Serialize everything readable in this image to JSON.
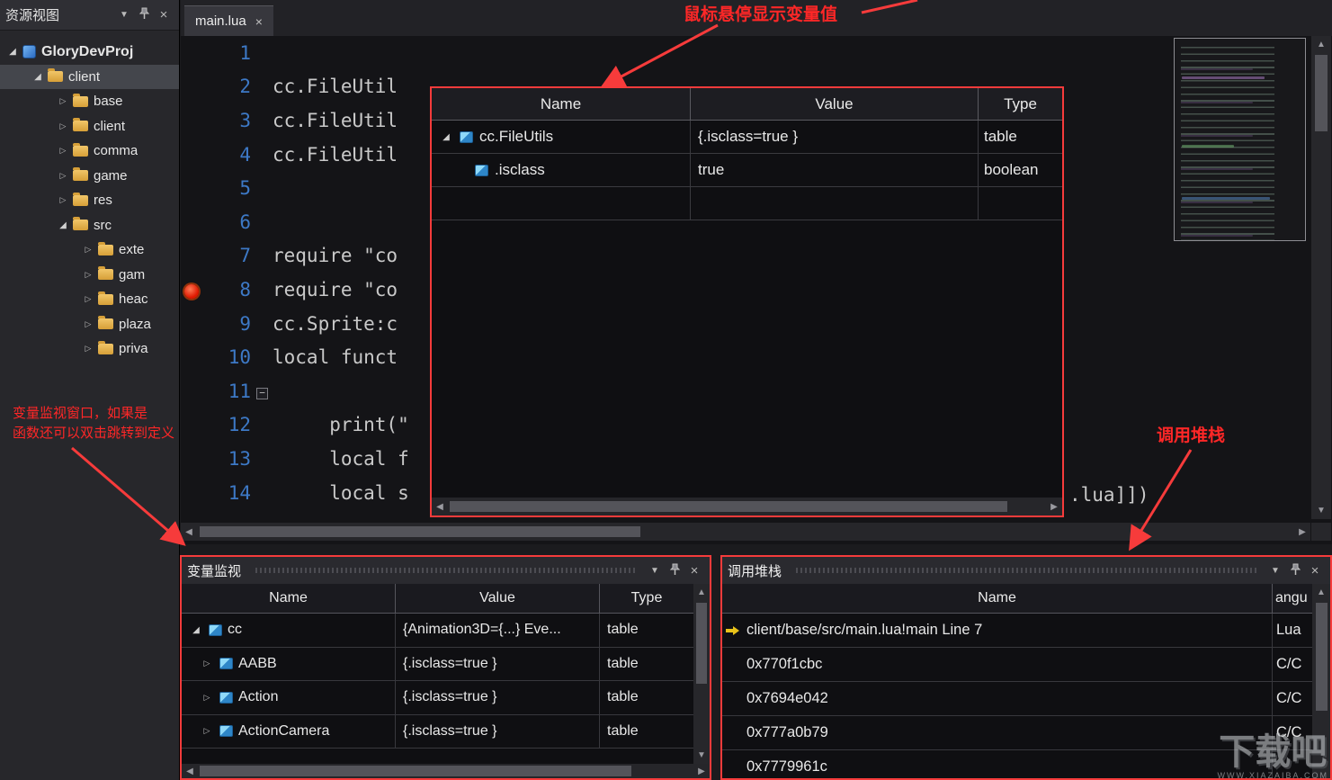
{
  "icons": {
    "chevron": "▼",
    "close": "×",
    "up": "▲",
    "down": "▼",
    "left": "◀",
    "right": "▶",
    "collapsed": "▷",
    "expanded": "◢",
    "fold": "−"
  },
  "resource_panel": {
    "title": "资源视图",
    "tree": [
      {
        "label": "GloryDevProj"
      },
      {
        "label": "client"
      },
      {
        "label": "base"
      },
      {
        "label": "client"
      },
      {
        "label": "comma"
      },
      {
        "label": "game"
      },
      {
        "label": "res"
      },
      {
        "label": "src"
      },
      {
        "label": "exte"
      },
      {
        "label": "gam"
      },
      {
        "label": "heac"
      },
      {
        "label": "plaza"
      },
      {
        "label": "priva"
      }
    ]
  },
  "editor": {
    "tab": "main.lua",
    "lines": [
      {
        "n": "1",
        "t": ""
      },
      {
        "n": "2",
        "t": "cc.FileUtil"
      },
      {
        "n": "3",
        "t": "cc.FileUtil"
      },
      {
        "n": "4",
        "t": "cc.FileUtil"
      },
      {
        "n": "5",
        "t": ""
      },
      {
        "n": "6",
        "t": ""
      },
      {
        "n": "7",
        "t": "require \"co"
      },
      {
        "n": "8",
        "t": "require \"co"
      },
      {
        "n": "9",
        "t": "cc.Sprite:c"
      },
      {
        "n": "10",
        "t": "local funct"
      },
      {
        "n": "11",
        "t": ""
      },
      {
        "n": "12",
        "t": "     print(\""
      },
      {
        "n": "13",
        "t": "     local f"
      },
      {
        "n": "14",
        "t": "     local s"
      }
    ],
    "line13_tail": ".lua]])"
  },
  "hover_popup": {
    "columns": [
      "Name",
      "Value",
      "Type"
    ],
    "rows": [
      {
        "name": "cc.FileUtils",
        "value": "{.isclass=true }",
        "type": "table"
      },
      {
        "name": ".isclass",
        "value": "true",
        "type": "boolean"
      },
      {
        "name": "",
        "value": "",
        "type": ""
      }
    ]
  },
  "watch_panel": {
    "title": "变量监视",
    "columns": [
      "Name",
      "Value",
      "Type"
    ],
    "rows": [
      {
        "name": "cc",
        "value": "{Animation3D={...} Eve...",
        "type": "table"
      },
      {
        "name": "AABB",
        "value": "{.isclass=true }",
        "type": "table"
      },
      {
        "name": "Action",
        "value": "{.isclass=true }",
        "type": "table"
      },
      {
        "name": "ActionCamera",
        "value": "{.isclass=true }",
        "type": "table"
      }
    ]
  },
  "callstack_panel": {
    "title": "调用堆栈",
    "columns": [
      "Name",
      "angu"
    ],
    "rows": [
      {
        "name": "client/base/src/main.lua!main Line 7",
        "lang": "Lua"
      },
      {
        "name": "0x770f1cbc",
        "lang": "C/C"
      },
      {
        "name": "0x7694e042",
        "lang": "C/C"
      },
      {
        "name": "0x777a0b79",
        "lang": "C/C"
      },
      {
        "name": "0x7779961c",
        "lang": ""
      }
    ]
  },
  "annotations": {
    "hover": "鼠标悬停显示变量值",
    "watch1": "变量监视窗口，如果是",
    "watch2": "函数还可以双击跳转到定义",
    "callstack": "调用堆栈"
  },
  "watermark": {
    "text": "下载吧",
    "sub": "WWW.XIAZAIBA.COM"
  }
}
